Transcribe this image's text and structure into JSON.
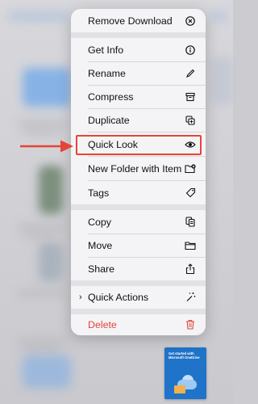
{
  "menu": {
    "items": [
      {
        "label": "Remove Download",
        "icon": "x-circle-icon"
      },
      {
        "label": "Get Info",
        "icon": "info-circle-icon"
      },
      {
        "label": "Rename",
        "icon": "pencil-icon"
      },
      {
        "label": "Compress",
        "icon": "archive-box-icon"
      },
      {
        "label": "Duplicate",
        "icon": "duplicate-plus-icon"
      },
      {
        "label": "Quick Look",
        "icon": "eye-icon"
      },
      {
        "label": "New Folder with Item",
        "icon": "folder-plus-icon"
      },
      {
        "label": "Tags",
        "icon": "tag-icon"
      },
      {
        "label": "Copy",
        "icon": "copy-docs-icon"
      },
      {
        "label": "Move",
        "icon": "folder-icon"
      },
      {
        "label": "Share",
        "icon": "share-icon"
      },
      {
        "label": "Quick Actions",
        "icon": "magic-wand-icon"
      },
      {
        "label": "Delete",
        "icon": "trash-icon"
      }
    ]
  },
  "thumbnail": {
    "caption": "Get started with Microsoft OneDrive"
  },
  "colors": {
    "highlight": "#e54536",
    "delete": "#e5423a"
  }
}
